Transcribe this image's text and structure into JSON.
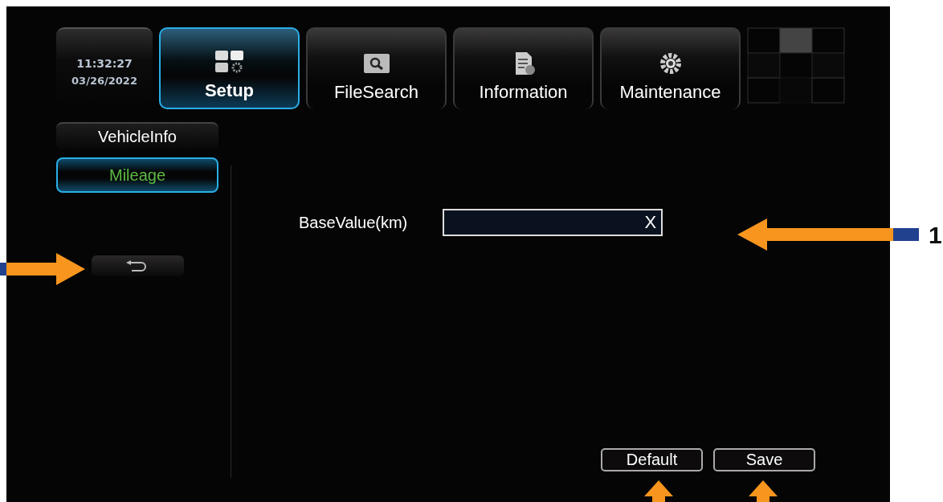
{
  "clock": {
    "time": "11:32:27",
    "date": "03/26/2022"
  },
  "tabs": [
    {
      "label": "Setup",
      "kind": "setup",
      "selected": true
    },
    {
      "label": "FileSearch",
      "kind": "search",
      "selected": false
    },
    {
      "label": "Information",
      "kind": "info",
      "selected": false
    },
    {
      "label": "Maintenance",
      "kind": "maintenance",
      "selected": false
    }
  ],
  "sidebar": {
    "items": [
      {
        "label": "VehicleInfo",
        "selected": false
      },
      {
        "label": "Mileage",
        "selected": true
      }
    ]
  },
  "form": {
    "label": "BaseValue(km)",
    "clear": "X"
  },
  "buttons": [
    "Default",
    "Save"
  ],
  "callouts": [
    {
      "label": "1"
    }
  ]
}
